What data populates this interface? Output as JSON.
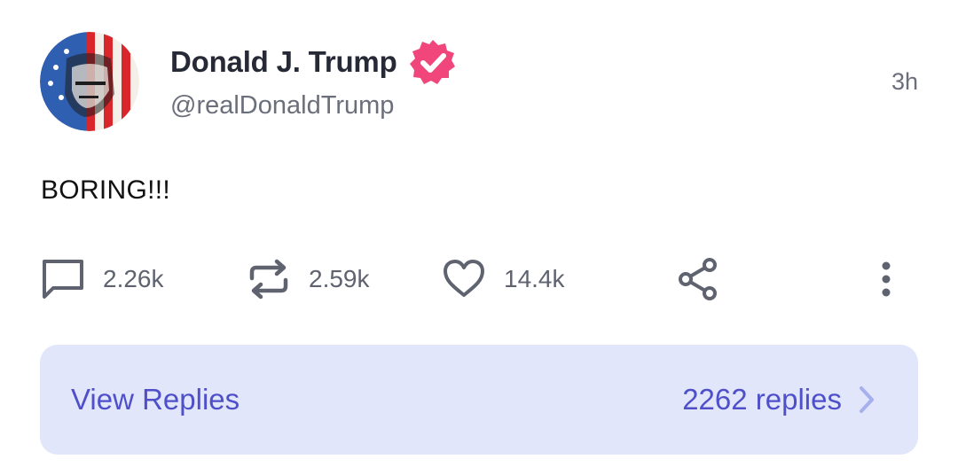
{
  "post": {
    "author": {
      "display_name": "Donald J. Trump",
      "handle": "@realDonaldTrump",
      "verified_icon": "verified-badge-icon",
      "badge_color": "#f0467b"
    },
    "time": "3h",
    "text": "BORING!!!"
  },
  "actions": {
    "reply": {
      "icon": "comment-icon",
      "count": "2.26k"
    },
    "repost": {
      "icon": "repost-icon",
      "count": "2.59k"
    },
    "like": {
      "icon": "heart-icon",
      "count": "14.4k"
    },
    "share": {
      "icon": "share-icon"
    },
    "more": {
      "icon": "more-vertical-icon"
    }
  },
  "replies_bar": {
    "label": "View Replies",
    "count_label": "2262 replies",
    "icon": "chevron-right-icon",
    "background": "#e1e6fb",
    "accent": "#4f50c9"
  }
}
